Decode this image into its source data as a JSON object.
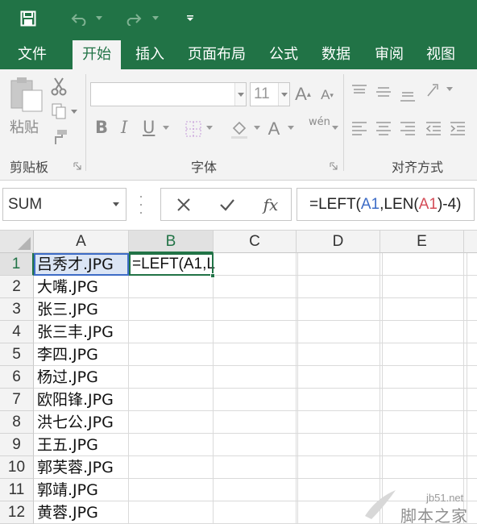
{
  "quick_access": {
    "icons": [
      "save-icon",
      "undo-icon",
      "redo-icon",
      "customize-icon"
    ]
  },
  "ribbon_tabs": [
    "文件",
    "开始",
    "插入",
    "页面布局",
    "公式",
    "数据",
    "审阅",
    "视图"
  ],
  "active_tab": "开始",
  "ribbon": {
    "clipboard": {
      "paste_label": "粘贴",
      "group_label": "剪贴板"
    },
    "font": {
      "font_name": "",
      "font_size": "11",
      "group_label": "字体",
      "bold": "B",
      "italic": "I",
      "underline": "U",
      "phonetic": "wén"
    },
    "alignment": {
      "group_label": "对齐方式"
    }
  },
  "formula_bar": {
    "name_box": "SUM",
    "fx_label": "fx",
    "formula_parts": [
      "=LEFT(",
      "A1",
      ",LEN(",
      "A1",
      ")-4)"
    ]
  },
  "sheet": {
    "columns": [
      "A",
      "B",
      "C",
      "D",
      "E"
    ],
    "rows": [
      "1",
      "2",
      "3",
      "4",
      "5",
      "6",
      "7",
      "8",
      "9",
      "10",
      "11",
      "12"
    ],
    "column_a": [
      "吕秀才.JPG",
      "大嘴.JPG",
      "张三.JPG",
      "张三丰.JPG",
      "李四.JPG",
      "杨过.JPG",
      "欧阳锋.JPG",
      "洪七公.JPG",
      "王五.JPG",
      "郭芙蓉.JPG",
      "郭靖.JPG",
      "黄蓉.JPG"
    ],
    "active_cell_text": "=LEFT(A1,L"
  },
  "colors": {
    "brand": "#217346",
    "reference_blue": "#3d6cc6",
    "reference_red": "#d44c57"
  },
  "watermark": {
    "url": "jb51.net",
    "name": "脚本之家"
  }
}
